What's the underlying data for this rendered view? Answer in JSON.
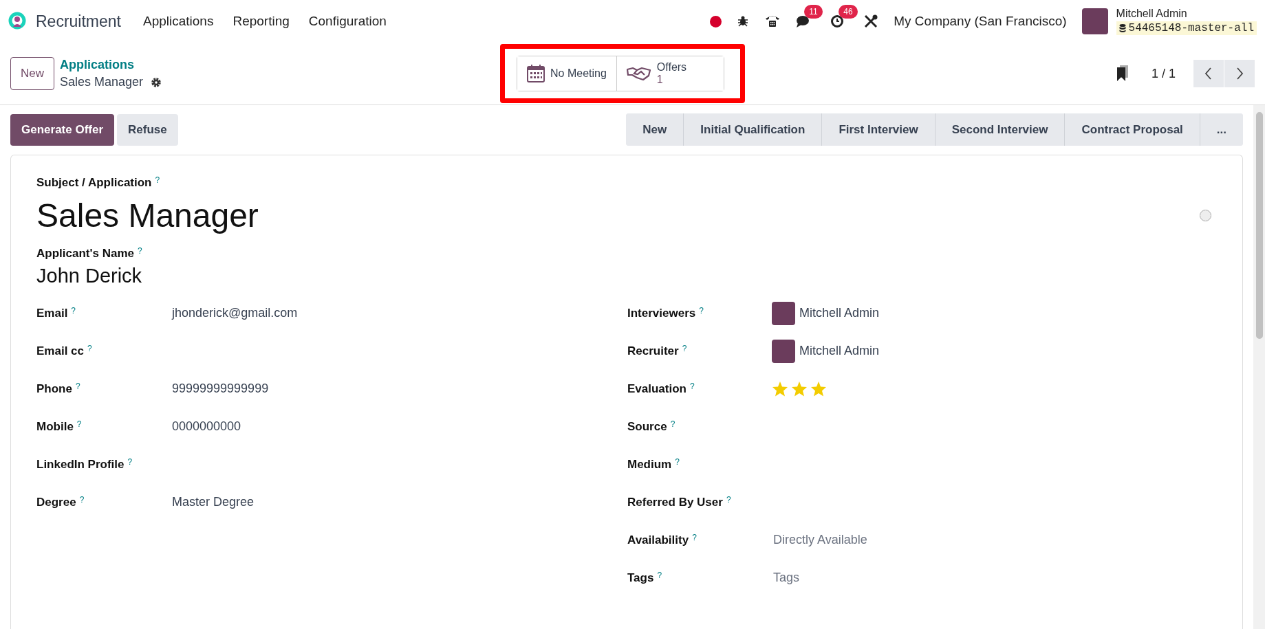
{
  "navbar": {
    "app": "Recruitment",
    "menus": [
      "Applications",
      "Reporting",
      "Configuration"
    ],
    "chat_count": "11",
    "activity_count": "46",
    "company": "My Company (San Francisco)",
    "user": "Mitchell Admin",
    "database": "54465148-master-all"
  },
  "control_panel": {
    "new_button": "New",
    "breadcrumb": "Applications",
    "record": "Sales Manager",
    "stat_buttons": [
      {
        "kind": "calendar",
        "label": "No Meeting"
      },
      {
        "kind": "handshake",
        "label": "Offers",
        "value": "1"
      }
    ],
    "pager": "1 / 1"
  },
  "actions": [
    {
      "label": "Generate Offer",
      "primary": true
    },
    {
      "label": "Refuse",
      "primary": false
    }
  ],
  "stages": [
    {
      "label": "New",
      "selected": false
    },
    {
      "label": "Initial Qualification",
      "selected": false
    },
    {
      "label": "First Interview",
      "selected": false
    },
    {
      "label": "Second Interview",
      "selected": false
    },
    {
      "label": "Contract Proposal",
      "selected": false
    },
    {
      "label": "...",
      "selected": false
    }
  ],
  "form": {
    "subject_label": "Subject / Application",
    "subject_help": "?",
    "title": "Sales Manager",
    "name_label": "Applicant's Name",
    "name_help": "?",
    "name": "John Derick",
    "left_fields": [
      {
        "label": "Email",
        "help": "?",
        "value": "jhonderick@gmail.com"
      },
      {
        "label": "Email cc",
        "help": "?"
      },
      {
        "label": "Phone",
        "help": "?",
        "value": "99999999999999"
      },
      {
        "label": "Mobile",
        "help": "?",
        "value": "0000000000"
      },
      {
        "label": "LinkedIn Profile",
        "help": "?"
      },
      {
        "label": "Degree",
        "help": "?",
        "value": "Master Degree"
      }
    ],
    "right_fields": [
      {
        "kind": "user",
        "label": "Interviewers",
        "help": "?",
        "value": "Mitchell Admin"
      },
      {
        "kind": "user",
        "label": "Recruiter",
        "help": "?",
        "value": "Mitchell Admin"
      },
      {
        "kind": "stars",
        "label": "Evaluation",
        "help": "?",
        "stars": 3
      },
      {
        "kind": "text",
        "label": "Source",
        "help": "?"
      },
      {
        "kind": "text",
        "label": "Medium",
        "help": "?"
      },
      {
        "kind": "text",
        "label": "Referred By User",
        "help": "?"
      },
      {
        "kind": "text",
        "label": "Availability",
        "help": "?",
        "placeholder": "Directly Available"
      },
      {
        "kind": "text",
        "label": "Tags",
        "help": "?",
        "placeholder": "Tags"
      }
    ]
  }
}
